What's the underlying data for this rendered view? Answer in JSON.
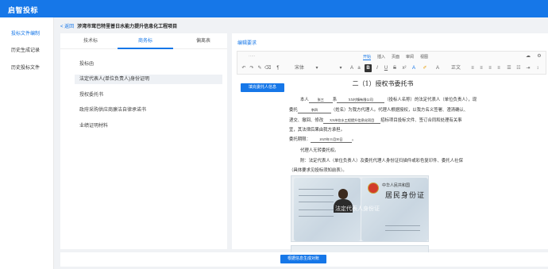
{
  "app": {
    "title": "启智投标"
  },
  "sidebar": {
    "items": [
      {
        "label": "投标文件编制",
        "active": true
      },
      {
        "label": "历史生成记录",
        "active": false
      },
      {
        "label": "历史投标文件",
        "active": false
      }
    ]
  },
  "header": {
    "back_label": "< 返回",
    "project_title": "涉湾市茸巴特里普日水能力提升信息化工程项目"
  },
  "left_panel": {
    "tabs": [
      {
        "label": "技术标",
        "active": false
      },
      {
        "label": "商务标",
        "active": true
      },
      {
        "label": "偏离表",
        "active": false
      }
    ],
    "docs": [
      {
        "label": "投标函",
        "active": false
      },
      {
        "label": "法定代表人(单位负责人)身份证明",
        "active": true
      },
      {
        "label": "授权委托书",
        "active": false
      },
      {
        "label": "政府采购供应商廉洁自律承诺书",
        "active": false
      },
      {
        "label": "业绩证明材料",
        "active": false
      }
    ]
  },
  "editor": {
    "section_title": "编辑要求",
    "menus": [
      "开始",
      "插入",
      "页面",
      "审阅",
      "视图"
    ],
    "active_menu": "开始",
    "font_name": "宋体",
    "style_name": "正文",
    "fill_button": "填充委托人信息"
  },
  "document": {
    "heading": "二（1）授权书委托书",
    "principal_name": "张三",
    "company_name": "XX村镇有限公司",
    "agent_name": "李四",
    "project_name": "XX市饮水工程提升信息化项目",
    "term": "2025年11月30日",
    "p1_a": "本人",
    "p1_b": "系",
    "p1_c": "（投标人名称）的法定代表人（单位负责人），现",
    "p2_a": "委托",
    "p2_b": "（姓名）为我方代理人。代理人根据授权，以我方名义签署、澄清确认、",
    "p3": "递交、撤回、修改",
    "p3_b": "招标项目投标文件、签订合同和处理有关事",
    "p4": "宜，其法律后果由我方承担。",
    "term_label": "委托期限：",
    "p5": "代理人无转委托权。",
    "p6": "附：法定代表人（单位负责人）及委托代理人身份证扫描件或彩色复印件、委托人社保",
    "p7": "（具体要求见投标须知前表）。",
    "id_top": "中华人民共和国",
    "id_big": "居民身份证",
    "watermark": "法定代表人身份证"
  },
  "footer": {
    "primary_button": "根据信息生成对账"
  }
}
